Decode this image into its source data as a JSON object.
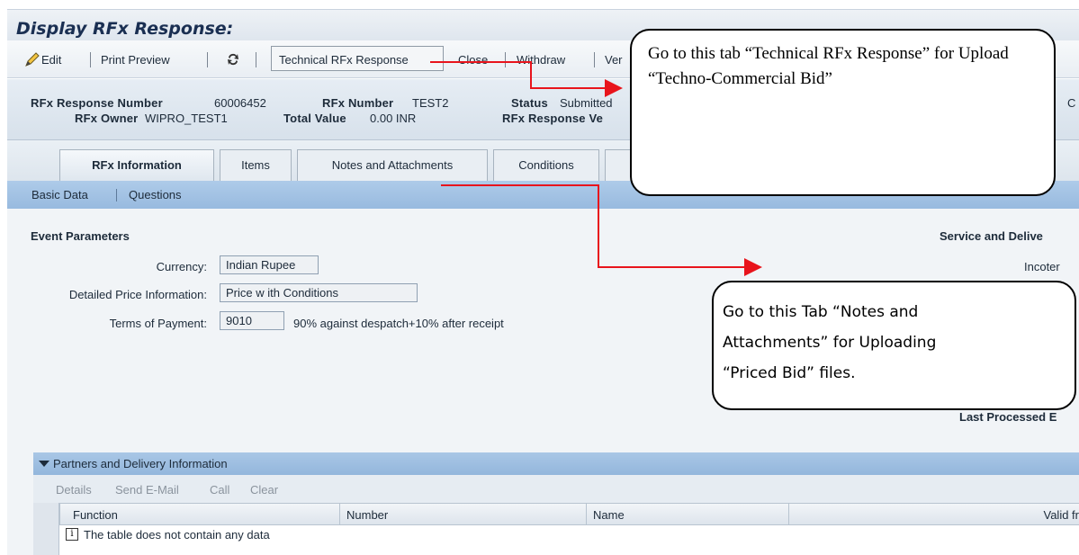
{
  "window": {
    "title": "Display RFx Response:"
  },
  "toolbar": {
    "edit_label": "Edit",
    "print_preview_label": "Print Preview",
    "technical_label": "Technical RFx Response",
    "close_label": "Close",
    "withdraw_label": "Withdraw",
    "ver_label": "Ver"
  },
  "header": {
    "response_number_label": "RFx Response Number",
    "response_number_value": "60006452",
    "owner_label": "RFx Owner",
    "owner_value": "WIPRO_TEST1",
    "rfx_number_label": "RFx Number",
    "rfx_number_value": "TEST2",
    "total_value_label": "Total Value",
    "total_value_value": "0.00 INR",
    "status_label": "Status",
    "status_value": "Submitted",
    "response_version_label": "RFx Response Ve",
    "right_cut": "C"
  },
  "tabs": [
    {
      "label": "RFx Information",
      "active": true
    },
    {
      "label": "Items"
    },
    {
      "label": "Notes and Attachments"
    },
    {
      "label": "Conditions"
    }
  ],
  "subnav": {
    "basic_data": "Basic Data",
    "questions": "Questions"
  },
  "event_parameters": {
    "title": "Event Parameters",
    "currency_label": "Currency:",
    "currency_value": "Indian Rupee",
    "price_info_label": "Detailed Price Information:",
    "price_info_value": "Price w ith Conditions",
    "payment_label": "Terms of Payment:",
    "payment_code": "9010",
    "payment_text": "90% against despatch+10% after receipt"
  },
  "service": {
    "title": "Service and Delive",
    "incoterms": "Incoter",
    "last_processed": "Last Processed E"
  },
  "callouts": {
    "technical": "Go to this tab “Technical RFx Response” for Upload “Techno-Commercial Bid”",
    "notes_line1": "Go to this Tab “Notes and",
    "notes_line2": "Attachments” for Uploading",
    "notes_line3": "“Priced Bid” files."
  },
  "partners": {
    "title": "Partners and Delivery Information",
    "toolbar": [
      "Details",
      "Send E-Mail",
      "Call",
      "Clear"
    ],
    "columns": [
      "Function",
      "Number",
      "Name",
      "Valid fr"
    ],
    "empty_message": "The table does not contain any data"
  },
  "colors": {
    "arrow": "#e8141c",
    "subnav": "#a3c4e6",
    "title": "#1a2f52"
  }
}
